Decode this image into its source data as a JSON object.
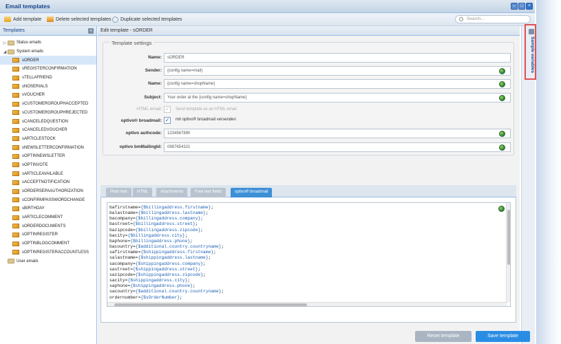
{
  "window": {
    "title": "Email templates"
  },
  "toolbar": {
    "add": "Add template",
    "delete": "Delete selected templates",
    "duplicate": "Duplicate selected templates",
    "search_placeholder": "Search..."
  },
  "left": {
    "header": "Templates",
    "tree": [
      {
        "label": "Status emails",
        "kind": "folder",
        "arrow": "▷",
        "level": 0
      },
      {
        "label": "System emails",
        "kind": "folder",
        "arrow": "◢",
        "level": 0
      },
      {
        "label": "sORDER",
        "kind": "mail",
        "level": 1,
        "selected": true
      },
      {
        "label": "sREGISTERCONFIRMATION",
        "kind": "mail",
        "level": 1
      },
      {
        "label": "sTELLAFRIEND",
        "kind": "mail",
        "level": 1
      },
      {
        "label": "sNOSERIALS",
        "kind": "mail",
        "level": 1
      },
      {
        "label": "sVOUCHER",
        "kind": "mail",
        "level": 1
      },
      {
        "label": "sCUSTOMERGROUPHACCEPTED",
        "kind": "mail",
        "level": 1
      },
      {
        "label": "sCUSTOMERGROUPHREJECTED",
        "kind": "mail",
        "level": 1
      },
      {
        "label": "sCANCELEDQUESTION",
        "kind": "mail",
        "level": 1
      },
      {
        "label": "sCANCELEDVOUCHER",
        "kind": "mail",
        "level": 1
      },
      {
        "label": "sARTICLESTOCK",
        "kind": "mail",
        "level": 1
      },
      {
        "label": "sNEWSLETTERCONFIRMATION",
        "kind": "mail",
        "level": 1
      },
      {
        "label": "sOPTINNEWSLETTER",
        "kind": "mail",
        "level": 1
      },
      {
        "label": "sOPTINVOTE",
        "kind": "mail",
        "level": 1
      },
      {
        "label": "sARTICLEAVAILABLE",
        "kind": "mail",
        "level": 1
      },
      {
        "label": "sACCEPTNOTIFICATION",
        "kind": "mail",
        "level": 1
      },
      {
        "label": "sORDERSEPAAUTHORIZATION",
        "kind": "mail",
        "level": 1
      },
      {
        "label": "sCONFIRMPASSWORDCHANGE",
        "kind": "mail",
        "level": 1
      },
      {
        "label": "sBIRTHDAY",
        "kind": "mail",
        "level": 1
      },
      {
        "label": "sARTICLECOMMENT",
        "kind": "mail",
        "level": 1
      },
      {
        "label": "sORDERDOCUMENTS",
        "kind": "mail",
        "level": 1
      },
      {
        "label": "sOPTINREGISTER",
        "kind": "mail",
        "level": 1
      },
      {
        "label": "sOPTINBLOGCOMMENT",
        "kind": "mail",
        "level": 1
      },
      {
        "label": "sOPTINREGISTERACCOUNTLESS",
        "kind": "mail",
        "level": 1
      },
      {
        "label": "User emails",
        "kind": "folder",
        "arrow": "",
        "level": 0
      }
    ]
  },
  "edit": {
    "header": "Edit template - sORDER",
    "settings_legend": "Template settings",
    "fields": {
      "name_label": "Name:",
      "name_value": "sORDER",
      "sender_label": "Sender:",
      "sender_value": "{config name=mail}",
      "fromname_label": "Name:",
      "fromname_value": "{config name=shopName}",
      "subject_label": "Subject:",
      "subject_value": "Your order at the {config name=shopName}",
      "html_label": "HTML email:",
      "html_text": "Send template as an HTML email",
      "broadmail_label": "optivo® broadmail:",
      "broadmail_text": "mit optivo® broadmail versenden",
      "authcode_label": "optivo authcode:",
      "authcode_value": "1234567890",
      "mailingid_label": "optivo bmMailingId:",
      "mailingid_value": "0987654321"
    },
    "tabs": [
      "Plain text",
      "HTML",
      "Attachments",
      "Free text fields",
      "optivo® broadmail"
    ],
    "active_tab": 4,
    "code_lines": [
      [
        "bafirstname=",
        "{$billingaddress.firstname}",
        ";"
      ],
      [
        "balastname=",
        "{$billingaddress.lastname}",
        ";"
      ],
      [
        "bacompany=",
        "{$billingaddress.company}",
        ";"
      ],
      [
        "bastreet=",
        "{$billingaddress.street}",
        ";"
      ],
      [
        "bazipcode=",
        "{$billingaddress.zipcode}",
        ";"
      ],
      [
        "bacity=",
        "{$billingaddress.city}",
        ";"
      ],
      [
        "baphone=",
        "{$billingaddress.phone}",
        ";"
      ],
      [
        "bacountry=",
        "{$additional.country.countryname}",
        ";"
      ],
      [
        "safirstname=",
        "{$shippingaddress.firstname}",
        ";"
      ],
      [
        "salastname=",
        "{$shippingaddress.lastname}",
        ";"
      ],
      [
        "sacompany=",
        "{$shippingaddress.company}",
        ";"
      ],
      [
        "sastreet=",
        "{$shippingaddress.street}",
        ";"
      ],
      [
        "sazipcode=",
        "{$shippingaddress.zipcode}",
        ";"
      ],
      [
        "sacity=",
        "{$shippingaddress.city}",
        ";"
      ],
      [
        "saphone=",
        "{$shippingaddress.phone}",
        ";"
      ],
      [
        "sacountry=",
        "{$additional.country.countryname}",
        ";"
      ],
      [
        "ordernumber=",
        "{$sOrderNumber}",
        ";"
      ]
    ]
  },
  "sidebar_right": {
    "label": "Sample variables"
  },
  "buttons": {
    "reset": "Reset template",
    "save": "Save template"
  },
  "colors": {
    "accent": "#3d8fd6",
    "save": "#2a8de4",
    "reset": "#a9b5c2",
    "highlight": "#e05050"
  }
}
